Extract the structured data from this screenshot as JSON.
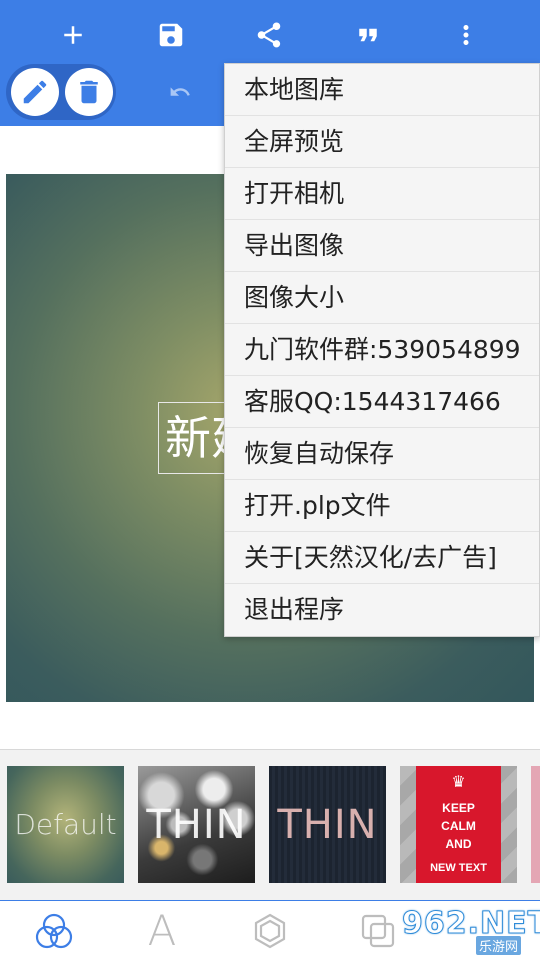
{
  "toolbar": {
    "icons": [
      "add-icon",
      "save-icon",
      "share-icon",
      "quote-icon",
      "more-vert-icon",
      "edit-icon",
      "delete-icon",
      "undo-icon"
    ],
    "accent_color": "#3d7ee6"
  },
  "canvas": {
    "text": "新建"
  },
  "menu": {
    "items": [
      "本地图库",
      "全屏预览",
      "打开相机",
      "导出图像",
      "图像大小",
      "九门软件群:539054899",
      "客服QQ:1544317466",
      "恢复自动保存",
      "打开.plp文件",
      "关于[天然汉化/去广告]",
      "退出程序"
    ]
  },
  "templates": [
    {
      "label": "Default"
    },
    {
      "label": "THIN"
    },
    {
      "label": "THIN"
    },
    {
      "lines": [
        "KEEP",
        "CALM",
        "AND",
        "NEW TEXT"
      ]
    }
  ],
  "bottom_nav": {
    "items": [
      "layers-icon",
      "text-icon",
      "shape-icon",
      "copy-icon"
    ],
    "text_label": "A"
  },
  "watermark": {
    "main": "962.NET",
    "sub": "乐游网"
  }
}
